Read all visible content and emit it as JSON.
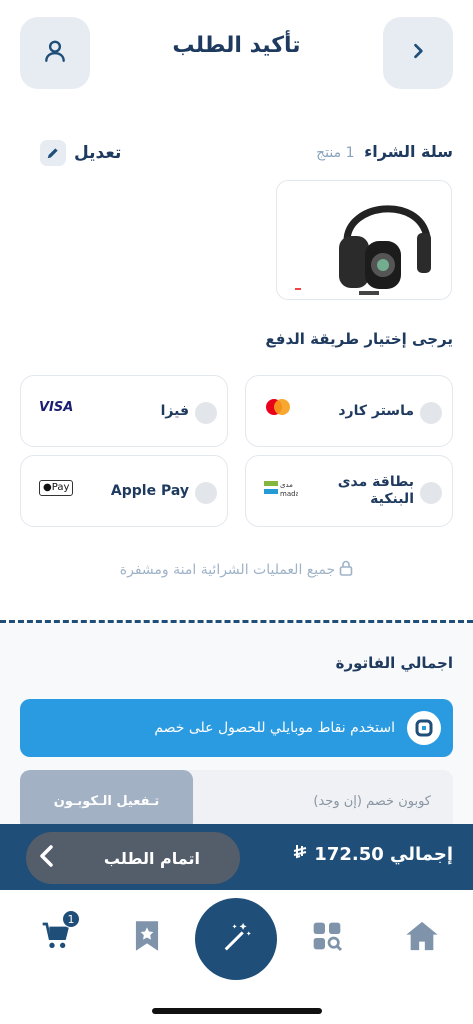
{
  "header": {
    "title": "تأكيد الطلب",
    "back_icon": "chevron-right-icon",
    "profile_icon": "user-icon"
  },
  "cart": {
    "title": "سلة الشراء",
    "count_text": "1 منتج",
    "edit_label": "تعديل",
    "product_image": "headphones"
  },
  "payment": {
    "title": "يرجى إختيار طريقة الدفع",
    "methods": [
      {
        "label": "ماستر كارد",
        "logo": "mastercard-logo"
      },
      {
        "label": "فيزا",
        "logo": "visa-logo",
        "logo_text": "VISA"
      },
      {
        "label_line1": "بطاقة مدى",
        "label_line2": "البنكية",
        "logo": "mada-logo",
        "logo_text_ar": "مدى",
        "logo_text_en": "mada"
      },
      {
        "label": "Apple Pay",
        "logo": "apple-pay-logo",
        "logo_text": "Pay"
      }
    ],
    "secure_note": "جميع العمليات الشرائية امنة ومشفرة"
  },
  "invoice": {
    "title": "اجمالي الفاتورة",
    "points_button": "استخدم نقاط موبايلي للحصول على خصم",
    "coupon_placeholder": "كوبون خصم (إن وجد)",
    "coupon_button": "تـفعيل الـكوبـون"
  },
  "total": {
    "label": "إجمالي",
    "amount": "172.50",
    "checkout_label": "اتمام الطلب"
  },
  "nav": {
    "cart_badge": "1"
  },
  "colors": {
    "primary": "#1f4e79",
    "accent_blue": "#2a9be0",
    "muted": "#a3b1c4"
  }
}
